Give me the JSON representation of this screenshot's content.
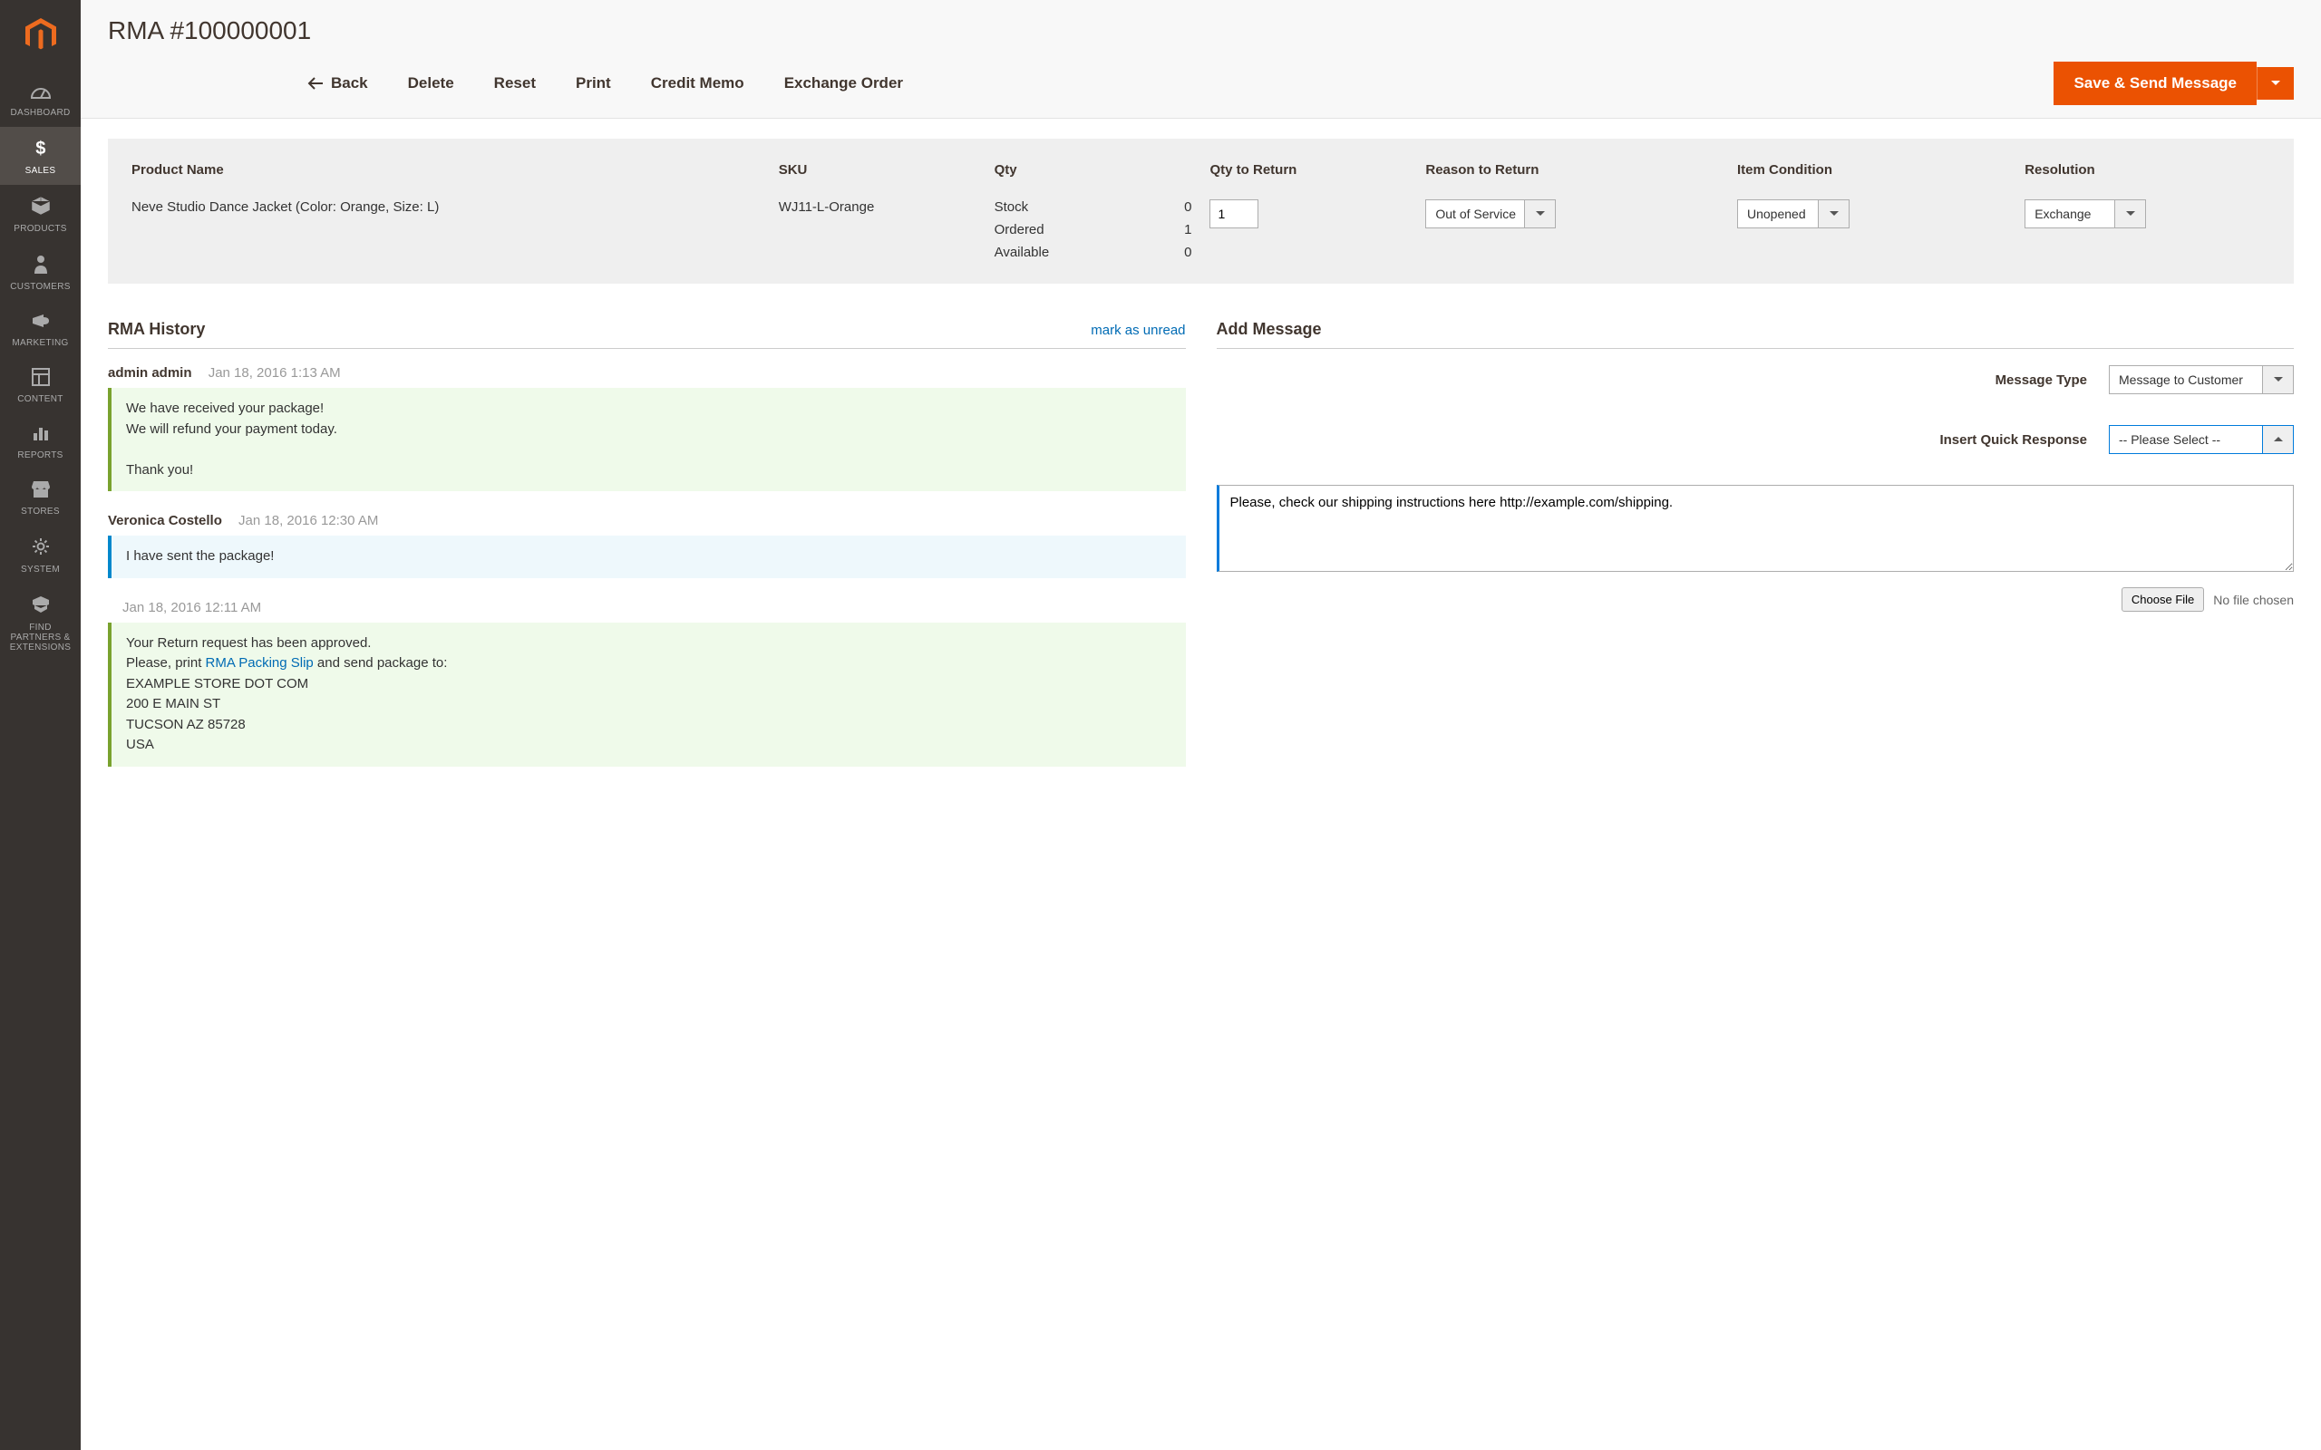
{
  "sidebar": {
    "items": [
      {
        "label": "DASHBOARD"
      },
      {
        "label": "SALES"
      },
      {
        "label": "PRODUCTS"
      },
      {
        "label": "CUSTOMERS"
      },
      {
        "label": "MARKETING"
      },
      {
        "label": "CONTENT"
      },
      {
        "label": "REPORTS"
      },
      {
        "label": "STORES"
      },
      {
        "label": "SYSTEM"
      },
      {
        "label": "FIND PARTNERS & EXTENSIONS"
      }
    ]
  },
  "header": {
    "title": "RMA #100000001",
    "back": "Back",
    "delete": "Delete",
    "reset": "Reset",
    "print": "Print",
    "credit_memo": "Credit Memo",
    "exchange_order": "Exchange Order",
    "save": "Save & Send Message"
  },
  "items": {
    "cols": {
      "product": "Product Name",
      "sku": "SKU",
      "qty": "Qty",
      "qty_return": "Qty to Return",
      "reason": "Reason to Return",
      "condition": "Item Condition",
      "resolution": "Resolution"
    },
    "rows": [
      {
        "product": "Neve Studio Dance Jacket (Color: Orange, Size: L)",
        "sku": "WJ11-L-Orange",
        "qty": {
          "stock_label": "Stock",
          "stock": "0",
          "ordered_label": "Ordered",
          "ordered": "1",
          "available_label": "Available",
          "available": "0"
        },
        "qty_return": "1",
        "reason": "Out of Service",
        "condition": "Unopened",
        "resolution": "Exchange"
      }
    ]
  },
  "history": {
    "title": "RMA History",
    "mark_unread": "mark as unread",
    "entries": [
      {
        "author": "admin admin",
        "date": "Jan 18, 2016 1:13 AM",
        "kind": "admin",
        "text": "We have received your package!\nWe will refund your payment today.\n\nThank you!"
      },
      {
        "author": "Veronica Costello",
        "date": "Jan 18, 2016 12:30 AM",
        "kind": "cust",
        "text": "I have sent the package!"
      },
      {
        "author": "",
        "date": "Jan 18, 2016 12:11 AM",
        "kind": "admin",
        "html_pre": "Your Return request has been approved.\nPlease, print ",
        "link_text": "RMA Packing Slip",
        "html_post": " and send package to:\nEXAMPLE STORE DOT COM\n200 E MAIN ST\nTUCSON AZ 85728\nUSA"
      }
    ]
  },
  "add_message": {
    "title": "Add Message",
    "type_label": "Message Type",
    "type_value": "Message to Customer",
    "qr_label": "Insert Quick Response",
    "qr_value": "-- Please Select --",
    "body": "Please, check our shipping instructions here http://example.com/shipping.",
    "choose_file": "Choose File",
    "no_file": "No file chosen"
  }
}
